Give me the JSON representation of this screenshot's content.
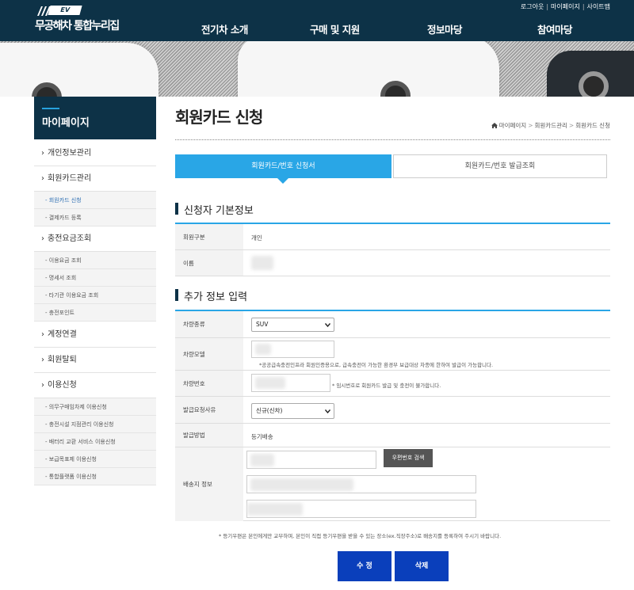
{
  "header": {
    "logo_badge": "EV",
    "logo_text": "무공해차 통합누리집",
    "utility_links": [
      "로그아웃",
      "마이페이지",
      "사이트맵"
    ],
    "nav": [
      "전기차 소개",
      "구매 및 지원",
      "정보마당",
      "참여마당"
    ]
  },
  "sidebar": {
    "title": "마이페이지",
    "items": [
      {
        "label": "개인정보관리"
      },
      {
        "label": "회원카드관리",
        "children": [
          "- 회원카드 신청",
          "- 결제카드 등록"
        ]
      },
      {
        "label": "충전요금조회",
        "children": [
          "- 이용요금 조회",
          "- 명세서 조회",
          "- 타기관 이용요금 조회",
          "- 충전포인트"
        ]
      },
      {
        "label": "계정연결"
      },
      {
        "label": "회원탈퇴"
      },
      {
        "label": "이용신청",
        "children": [
          "- 의무구매임차제 이용신청",
          "- 충전시설 지점관리 이용신청",
          "- 배터리 교환 서비스 이용신청",
          "- 보급목표제 이용신청",
          "- 통합플랫폼 이용신청"
        ]
      }
    ]
  },
  "page": {
    "title": "회원카드 신청",
    "breadcrumb": [
      "마이페이지",
      "회원카드관리",
      "회원카드 신청"
    ]
  },
  "tabs": [
    "회원카드/번호 신청서",
    "회원카드/번호 발급조회"
  ],
  "basic_info": {
    "heading": "신청자 기본정보",
    "rows": [
      {
        "label": "회원구분",
        "value": "개인"
      },
      {
        "label": "이름",
        "value": ""
      }
    ]
  },
  "extra_info": {
    "heading": "추가 정보 입력",
    "vehicle_type": {
      "label": "차량종류",
      "selected": "SUV"
    },
    "vehicle_model": {
      "label": "차량모델",
      "note": "*공공급속충전인프라 회원인증용으로, 급속충전이 가능한 환경부 보급대상 차종에 한하여 발급이 가능합니다."
    },
    "vehicle_number": {
      "label": "차량번호",
      "note": "* 임시번호로 회원카드 발급 및 충전이 불가합니다."
    },
    "issue_reason": {
      "label": "발급요청사유",
      "selected": "신규(신차)"
    },
    "issue_method": {
      "label": "발급방법",
      "value": "등기배송"
    },
    "address": {
      "label": "배송지 정보",
      "zip_button": "우편번호 검색"
    }
  },
  "footer_note": "* 등기우편은 본인에게만 교부하며, 본인이 직접 등기우편을 받을 수 있는 장소(ex.직장주소)로 배송지를 등록하여 주시기 바랍니다.",
  "buttons": {
    "edit": "수 정",
    "delete": "삭제"
  },
  "colors": {
    "header": "#0d3247",
    "accent": "#29a6e6",
    "button": "#0a3fbb"
  }
}
